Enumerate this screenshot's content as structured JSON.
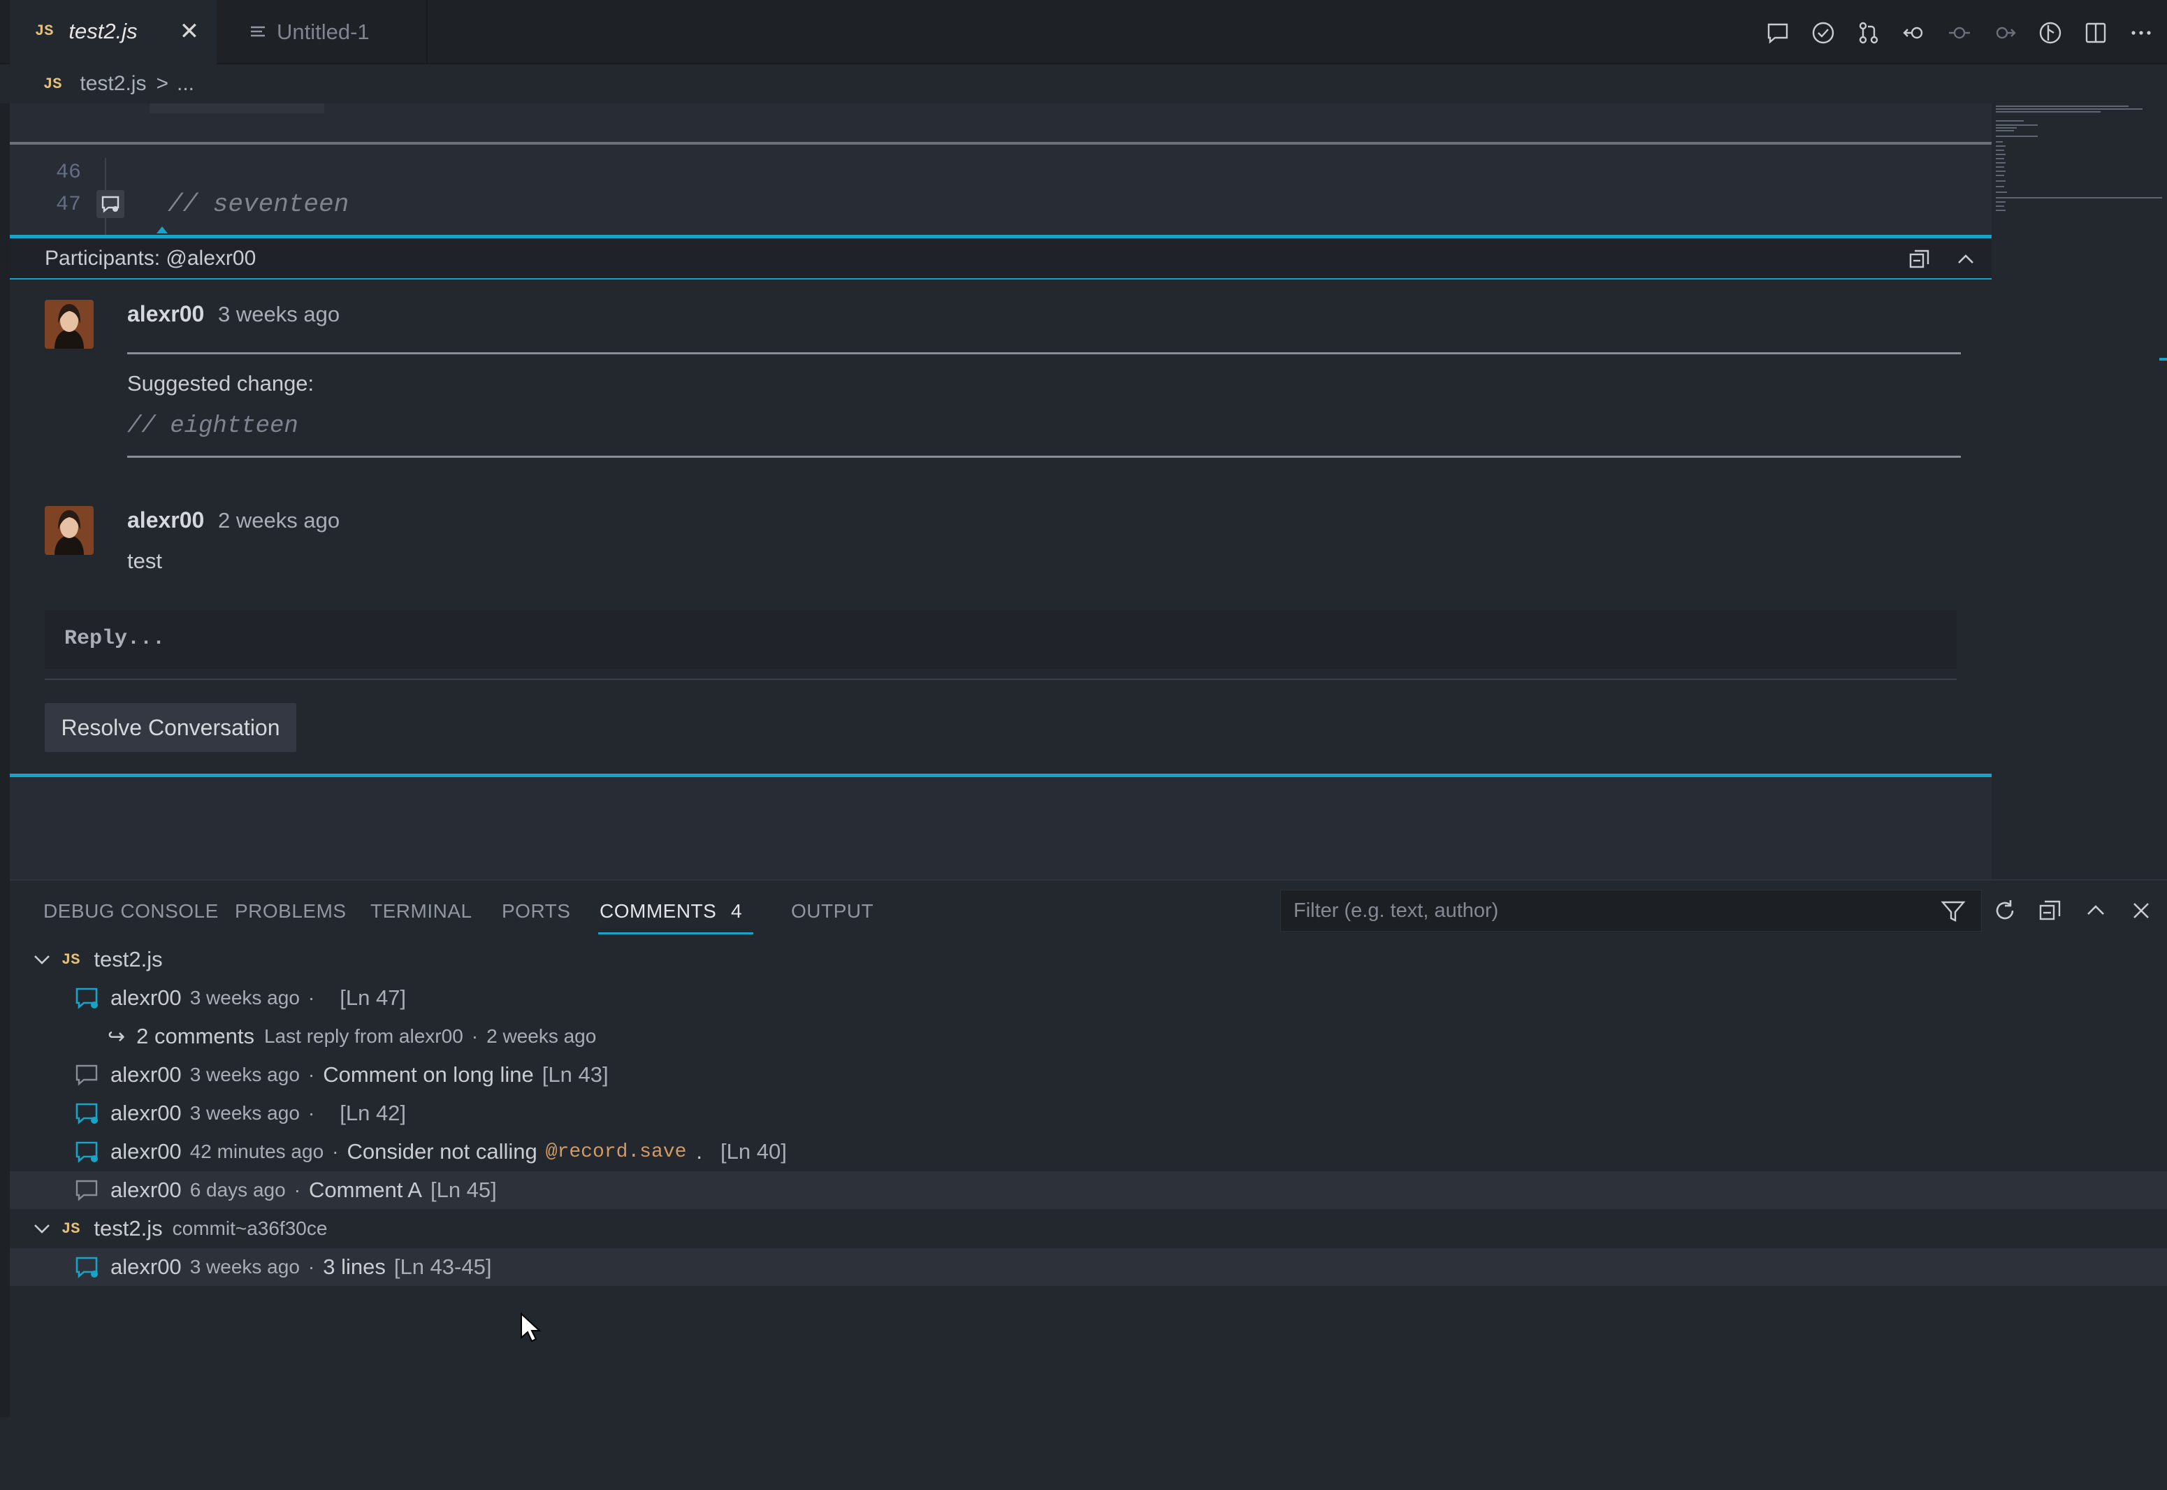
{
  "tabs": [
    {
      "icon": "JS",
      "label": "test2.js",
      "active": true
    },
    {
      "icon": "lines-icon",
      "label": "Untitled-1",
      "active": false
    }
  ],
  "breadcrumb": {
    "icon": "JS",
    "file": "test2.js",
    "separator": ">",
    "rest": "..."
  },
  "editor": {
    "lines": [
      {
        "number": "46",
        "text": ""
      },
      {
        "number": "47",
        "text": "// seventeen"
      }
    ]
  },
  "comment_thread": {
    "participants": "Participants: @alexr00",
    "comments": [
      {
        "author": "alexr00",
        "ago": "3 weeks ago",
        "suggestion_label": "Suggested change:",
        "suggestion_code": "// eightteen"
      },
      {
        "author": "alexr00",
        "ago": "2 weeks ago",
        "body": "test"
      }
    ],
    "reply_placeholder": "Reply...",
    "resolve_label": "Resolve Conversation"
  },
  "panel": {
    "tabs": [
      "DEBUG CONSOLE",
      "PROBLEMS",
      "TERMINAL",
      "PORTS",
      "COMMENTS",
      "OUTPUT"
    ],
    "active_tab": "COMMENTS",
    "comments_count": "4",
    "filter_placeholder": "Filter (e.g. text, author)"
  },
  "comments_tree": {
    "group1": {
      "icon": "JS",
      "file": "test2.js",
      "items": [
        {
          "author": "alexr00",
          "ago": "3 weeks ago",
          "sep": "·",
          "text": "",
          "loc": "[Ln 47]"
        },
        {
          "count": "2 comments",
          "last_reply": "Last reply from alexr00",
          "sep": "·",
          "ago": "2 weeks ago"
        },
        {
          "author": "alexr00",
          "ago": "3 weeks ago",
          "sep": "·",
          "text": "Comment on long line",
          "loc": "[Ln 43]"
        },
        {
          "author": "alexr00",
          "ago": "3 weeks ago",
          "sep": "·",
          "text": "",
          "loc": "[Ln 42]"
        },
        {
          "author": "alexr00",
          "ago": "42 minutes ago",
          "sep": "·",
          "text": "Consider not calling",
          "code": "@record.save",
          "after": ".",
          "loc": "[Ln 40]"
        },
        {
          "author": "alexr00",
          "ago": "6 days ago",
          "sep": "·",
          "text": "Comment A",
          "loc": "[Ln 45]"
        }
      ]
    },
    "group2": {
      "icon": "JS",
      "file": "test2.js",
      "ref": "commit~a36f30ce",
      "items": [
        {
          "author": "alexr00",
          "ago": "3 weeks ago",
          "sep": "·",
          "text": "3 lines",
          "loc": "[Ln 43-45]"
        }
      ]
    }
  },
  "colors": {
    "accent": "#18a3c9",
    "js_icon": "#e5c07b",
    "code_inline": "#d19a66"
  }
}
